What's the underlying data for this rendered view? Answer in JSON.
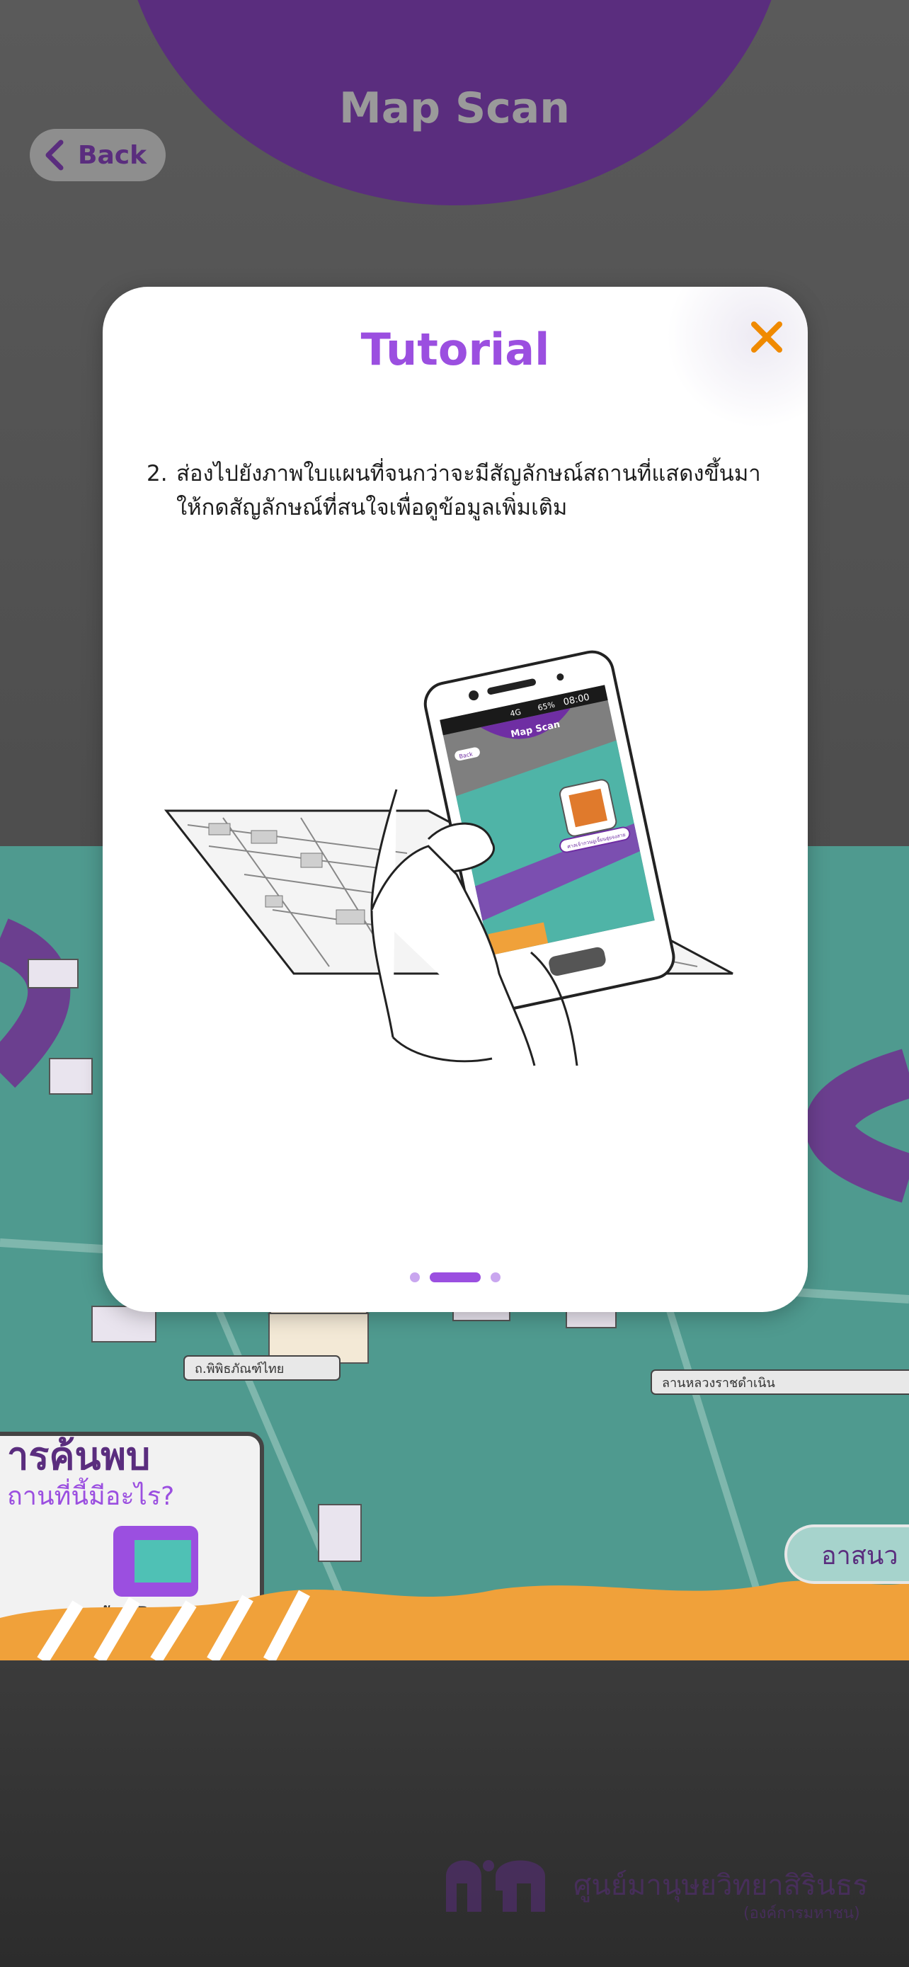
{
  "app": {
    "title": "Map Scan",
    "back_label": "Back"
  },
  "tutorial": {
    "title": "Tutorial",
    "step_number": "2.",
    "instruction_line1": "ส่องไปยังภาพใบแผนที่จนกว่าจะมีสัญลักษณ์สถานที่แสดงขึ้นมา",
    "instruction_line2": "ให้กดสัญลักษณ์ที่สนใจเพื่อดูข้อมูลเพิ่มเติม",
    "pages_total": 3,
    "current_page": 2,
    "illustration": {
      "phone_status_time": "08:00",
      "phone_status_battery": "65%",
      "phone_status_network": "4G",
      "phone_app_title": "Map Scan",
      "phone_back_label": "Back",
      "marker_label": "ศาลเจ้ากวนอูเจี้ยนฮุ่ยจงสาย"
    }
  },
  "background": {
    "map_banner_text_1": "ารค้นพบ",
    "map_banner_text_2": "ถานที่นี้มีอะไร?",
    "map_ar_label": "สนุกกับ AR",
    "map_place_label_1": "ถ.พิพิธภัณฑ์ไทย",
    "map_place_label_2": "ลานหลวงราชดำเนิน",
    "map_button_text": "อาสนว"
  },
  "branding": {
    "logo_text": "ศูนย์มานุษยวิทยาสิรินธร",
    "logo_subtext": "(องค์การมหาชน)"
  },
  "colors": {
    "brand_purple": "#5a2d7e",
    "accent_purple": "#9b4fe0",
    "close_orange": "#f08a00",
    "map_teal": "#4f9a8f"
  },
  "icons": {
    "back": "chevron-left-icon",
    "close": "close-x-icon"
  }
}
